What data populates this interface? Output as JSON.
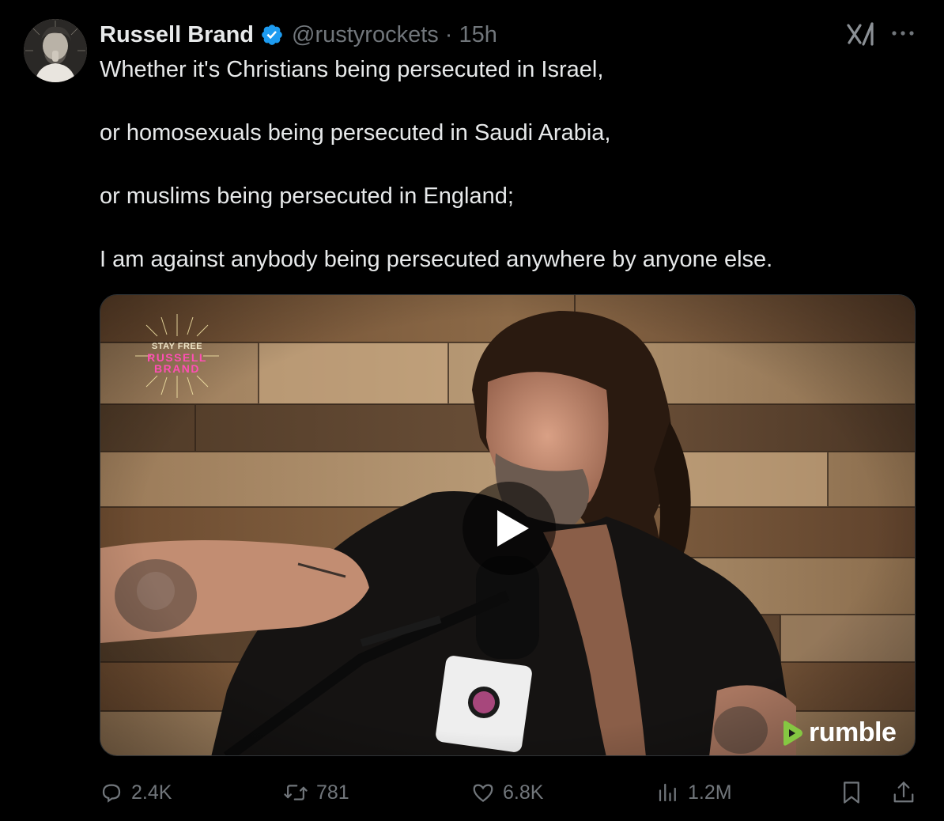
{
  "author": {
    "name": "Russell Brand",
    "handle": "@rustyrockets",
    "separator": "·",
    "time": "15h",
    "verified": true
  },
  "tweet": {
    "paragraphs": [
      "Whether it's Christians being persecuted in Israel,",
      "or homosexuals being persecuted in Saudi Arabia,",
      "or muslims being persecuted in England;",
      "I am against anybody being persecuted anywhere by anyone else."
    ]
  },
  "media": {
    "type": "video",
    "badge": {
      "line1": "STAY FREE",
      "line2": "RUSSELL",
      "line3": "BRAND"
    },
    "watermark": "rumble"
  },
  "actions": {
    "replies": "2.4K",
    "retweets": "781",
    "likes": "6.8K",
    "views": "1.2M"
  },
  "colors": {
    "background": "#000000",
    "text": "#e7e9ea",
    "muted": "#71767b",
    "verified": "#1d9bf0",
    "rumble_green": "#85c742"
  },
  "icons": {
    "reply": "reply-icon",
    "retweet": "retweet-icon",
    "like": "heart-icon",
    "views": "views-icon",
    "bookmark": "bookmark-icon",
    "share": "share-icon",
    "grok": "grok-icon",
    "more": "more-icon",
    "play": "play-icon"
  }
}
